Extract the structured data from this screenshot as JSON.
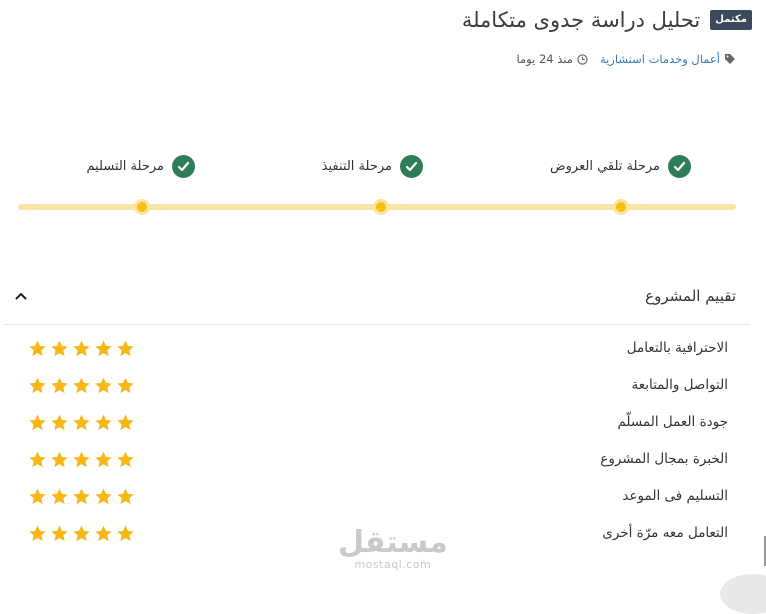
{
  "header": {
    "badge": "مكتمل",
    "title": "تحليل دراسة جدوى متكاملة"
  },
  "meta": {
    "category": "أعمال وخدمات استشارية",
    "time": "منذ 24 يوما",
    "tag_icon": "tag-icon",
    "clock_icon": "clock-icon"
  },
  "stages": [
    {
      "label": "مرحلة تلقي العروض",
      "completed": true
    },
    {
      "label": "مرحلة التنفيذ",
      "completed": true
    },
    {
      "label": "مرحلة التسليم",
      "completed": true
    }
  ],
  "ratings": {
    "title": "تقييم المشروع",
    "items": [
      {
        "label": "الاحترافية بالتعامل",
        "stars": 5
      },
      {
        "label": "التواصل والمتابعة",
        "stars": 5
      },
      {
        "label": "جودة العمل المسلّم",
        "stars": 5
      },
      {
        "label": "الخبرة بمجال المشروع",
        "stars": 5
      },
      {
        "label": "التسليم فى الموعد",
        "stars": 5
      },
      {
        "label": "التعامل معه مرّة أخرى",
        "stars": 5
      }
    ]
  },
  "watermark": {
    "text": "مستقل",
    "url": "mostaql.com"
  },
  "colors": {
    "check": "#2e7d57",
    "track": "#f9e4a3",
    "dot": "#f7c013",
    "star": "#f7b718",
    "badge": "#3a4a5a",
    "link": "#3b7bb5"
  }
}
